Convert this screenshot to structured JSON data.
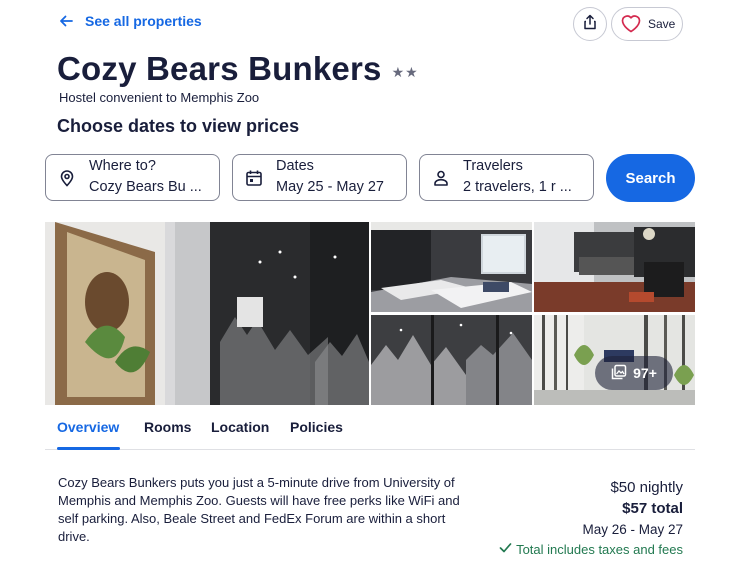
{
  "nav": {
    "back_label": "See all properties",
    "share_icon": "share-icon",
    "save_label": "Save"
  },
  "header": {
    "title": "Cozy Bears Bunkers",
    "stars": "★★",
    "star_rating": 2,
    "subtitle": "Hostel convenient to Memphis Zoo",
    "choose_prompt": "Choose dates to view prices"
  },
  "search": {
    "where": {
      "label": "Where to?",
      "value": "Cozy Bears Bu ..."
    },
    "dates": {
      "label": "Dates",
      "value": "May 25 - May 27"
    },
    "travelers": {
      "label": "Travelers",
      "value": "2 travelers, 1 r   ..."
    },
    "button_label": "Search"
  },
  "gallery": {
    "photo_count": "97+"
  },
  "tabs": [
    "Overview",
    "Rooms",
    "Location",
    "Policies"
  ],
  "overview": {
    "description": "Cozy Bears Bunkers puts you just a 5-minute drive from University of Memphis and Memphis Zoo. Guests will have free perks like WiFi and self parking. Also, Beale Street and FedEx Forum are within a short drive."
  },
  "price": {
    "nightly": "$50 nightly",
    "total": "$57 total",
    "dates": "May 26 - May 27",
    "taxes_note": "Total includes taxes and fees"
  },
  "colors": {
    "accent": "#1668e3",
    "text": "#191e3b",
    "success": "#227950"
  }
}
